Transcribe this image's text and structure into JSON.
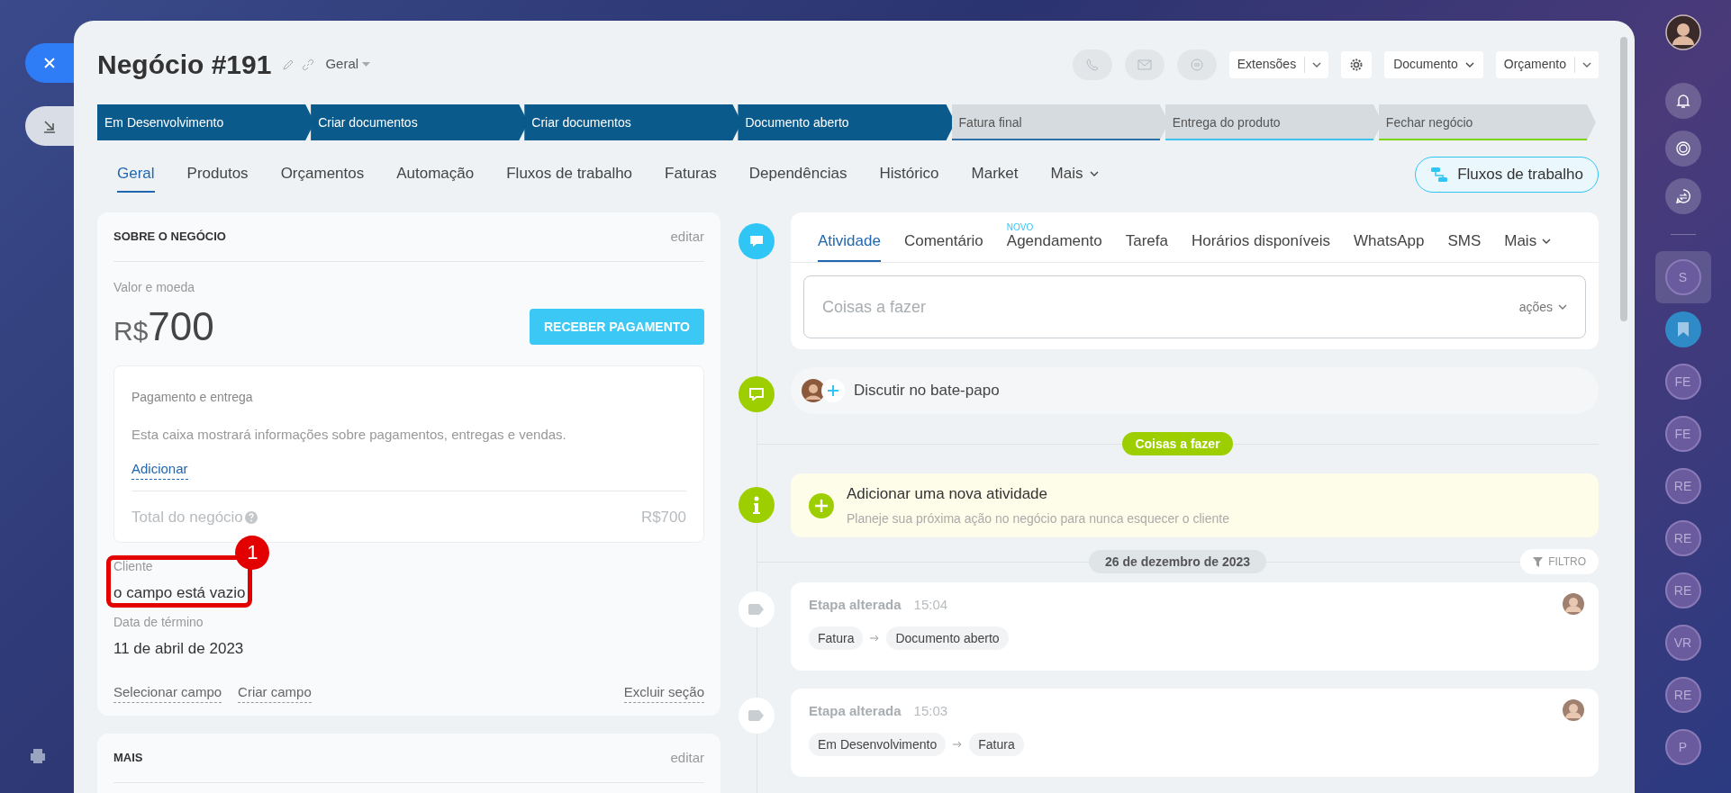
{
  "header": {
    "title": "Negócio #191",
    "category": "Geral",
    "buttons": [
      {
        "kind": "split",
        "label": "Extensões"
      },
      {
        "kind": "gear"
      },
      {
        "kind": "dropdown",
        "label": "Documento"
      },
      {
        "kind": "split",
        "label": "Orçamento"
      }
    ]
  },
  "stages": [
    {
      "label": "Em Desenvolvimento",
      "passed": true,
      "color": "#0b5a8c"
    },
    {
      "label": "Criar documentos",
      "passed": true,
      "color": "#0b5a8c"
    },
    {
      "label": "Criar documentos",
      "passed": true,
      "color": "#0b5a8c"
    },
    {
      "label": "Documento aberto",
      "passed": true,
      "color": "#0b5a8c"
    },
    {
      "label": "Fatura final",
      "passed": false,
      "color": "#2f6fa8"
    },
    {
      "label": "Entrega do produto",
      "passed": false,
      "color": "#3cc3f0"
    },
    {
      "label": "Fechar negócio",
      "passed": false,
      "color": "#7bd500"
    }
  ],
  "tabs": [
    {
      "label": "Geral",
      "selected": true
    },
    {
      "label": "Produtos",
      "selected": false
    },
    {
      "label": "Orçamentos",
      "selected": false
    },
    {
      "label": "Automação",
      "selected": false
    },
    {
      "label": "Fluxos de trabalho",
      "selected": false
    },
    {
      "label": "Faturas",
      "selected": false
    },
    {
      "label": "Dependências",
      "selected": false
    },
    {
      "label": "Histórico",
      "selected": false
    },
    {
      "label": "Market",
      "selected": false
    },
    {
      "label": "Mais",
      "selected": false
    }
  ],
  "workflow_button": "Fluxos de trabalho",
  "about": {
    "title": "SOBRE O NEGÓCIO",
    "edit": "editar",
    "value_label": "Valor e moeda",
    "currency": "R$",
    "amount": "700",
    "pay_button": "RECEBER PAGAMENTO",
    "payment": {
      "title": "Pagamento e entrega",
      "text": "Esta caixa mostrará informações sobre pagamentos, entregas e vendas.",
      "link": "Adicionar",
      "total_label": "Total do negócio",
      "total": "R$700"
    },
    "fields": [
      {
        "label": "Cliente",
        "value": "o campo está vazio",
        "highlighted": true,
        "badge": "1"
      },
      {
        "label": "Data de término",
        "value": "11 de abril de 2023",
        "highlighted": false
      }
    ],
    "links": [
      "Selecionar campo",
      "Criar campo"
    ],
    "delete_link": "Excluir seção"
  },
  "more": {
    "title": "MAIS",
    "edit": "editar"
  },
  "composer": {
    "tabs": [
      {
        "label": "Atividade",
        "selected": true
      },
      {
        "label": "Comentário",
        "selected": false
      },
      {
        "label": "Agendamento",
        "selected": false,
        "badge": "NOVO"
      },
      {
        "label": "Tarefa",
        "selected": false
      },
      {
        "label": "Horários disponíveis",
        "selected": false
      },
      {
        "label": "WhatsApp",
        "selected": false
      },
      {
        "label": "SMS",
        "selected": false
      },
      {
        "label": "Mais",
        "selected": false
      }
    ],
    "placeholder": "Coisas a fazer",
    "actions": "ações"
  },
  "chat": "Discutir no bate-papo",
  "todo_divider": "Coisas a fazer",
  "add_activity": {
    "title": "Adicionar uma nova atividade",
    "subtitle": "Planeje sua próxima ação no negócio para nunca esquecer o cliente"
  },
  "date": "26 de dezembro de 2023",
  "filter": "FILTRO",
  "events": [
    {
      "title": "Etapa alterada",
      "time": "15:04",
      "from": "Fatura",
      "to": "Documento aberto"
    },
    {
      "title": "Etapa alterada",
      "time": "15:03",
      "from": "Em Desenvolvimento",
      "to": "Fatura"
    }
  ],
  "sidebar": [
    {
      "initials": "S",
      "selected": true
    },
    {
      "kind": "bookmark"
    },
    {
      "initials": "FE",
      "selected": false
    },
    {
      "initials": "FE",
      "selected": false
    },
    {
      "initials": "RE",
      "selected": false
    },
    {
      "initials": "RE",
      "selected": false
    },
    {
      "initials": "RE",
      "selected": false
    },
    {
      "initials": "VR",
      "selected": false
    },
    {
      "initials": "RE",
      "selected": false
    },
    {
      "initials": "P",
      "selected": false
    }
  ]
}
